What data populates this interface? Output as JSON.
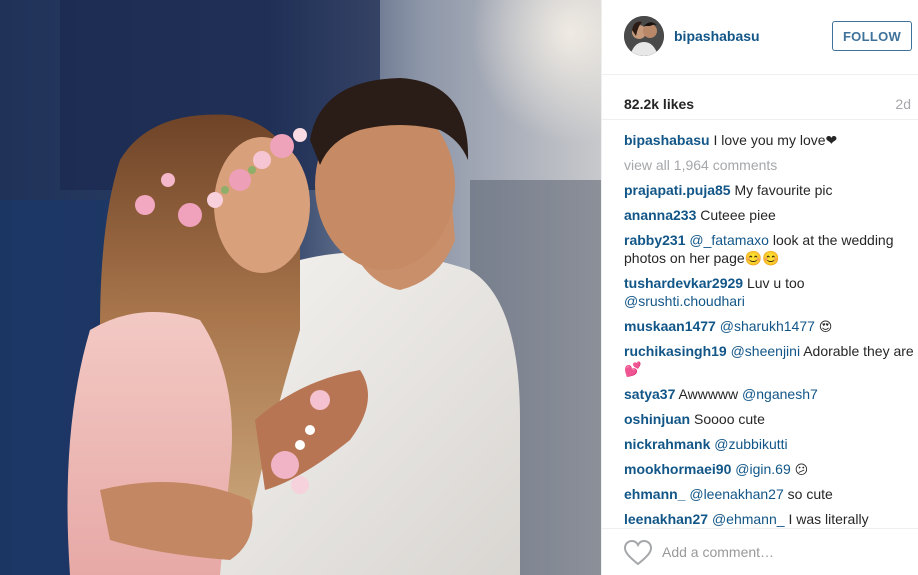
{
  "post": {
    "photo": {
      "description_icon": "couple-photo"
    }
  },
  "header": {
    "username": "bipashabasu",
    "follow_label": "FOLLOW",
    "colors": {
      "link": "#125688",
      "follow_border": "#3f729b"
    }
  },
  "stats": {
    "likes": "82.2k likes",
    "age": "2d"
  },
  "caption": {
    "user": "bipashabasu",
    "text": "I love you my love❤"
  },
  "view_all": "view all 1,964 comments",
  "comments": [
    {
      "user": "prajapati.puja85",
      "text": "My favourite pic"
    },
    {
      "user": "ananna233",
      "text": "Cuteee piee"
    },
    {
      "user": "rabby231",
      "mention": "@_fatamaxo",
      "text": "look at the wedding photos on her page😊😊"
    },
    {
      "user": "tushardevkar2929",
      "text": "Luv u too",
      "mention2": "@srushti.choudhari"
    },
    {
      "user": "muskaan1477",
      "mention": "@sharukh1477",
      "text": "😍"
    },
    {
      "user": "ruchikasingh19",
      "mention": "@sheenjini",
      "text": "Adorable they are 💕"
    },
    {
      "user": "satya37",
      "text": "Awwwww",
      "mention2": "@nganesh7"
    },
    {
      "user": "oshinjuan",
      "text": "Soooo cute"
    },
    {
      "user": "nickrahmank",
      "mention": "@zubbikutti",
      "text": ""
    },
    {
      "user": "mookhormaei90",
      "mention": "@igin.69",
      "text": "😕"
    },
    {
      "user": "ehmann_",
      "mention": "@leenakhan27",
      "text": "so cute"
    },
    {
      "user": "leenakhan27",
      "mention": "@ehmann_",
      "text": "I was literally"
    }
  ],
  "footer": {
    "placeholder": "Add a comment…",
    "icon": "heart-outline-icon"
  }
}
